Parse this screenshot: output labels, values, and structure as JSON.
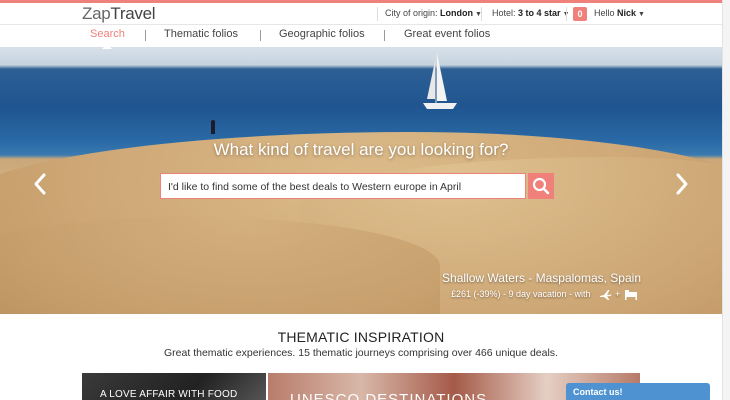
{
  "header": {
    "logo_zap": "Zap",
    "logo_travel": "Travel",
    "city_label": "City of origin:",
    "city_value": "London",
    "hotel_label": "Hotel:",
    "hotel_value": "3 to 4 star",
    "notifications_count": "0",
    "greeting": "Hello",
    "user_name": "Nick"
  },
  "nav": {
    "items": [
      "Search",
      "Thematic folios",
      "Geographic folios",
      "Great event folios"
    ],
    "active": "Search"
  },
  "hero": {
    "title": "What kind of travel are you looking for?",
    "search_value": "I'd like to find some of the best deals to Western europe in April",
    "caption": "Shallow Waters - Maspalomas, Spain",
    "sub_caption": "£261 (-39%) - 9 day vacation - with",
    "plus": "+"
  },
  "section": {
    "title": "THEMATIC INSPIRATION",
    "subtitle": "Great thematic experiences. 15 thematic journeys comprising over 466 unique deals.",
    "tiles": [
      {
        "label": "A LOVE AFFAIR WITH FOOD"
      },
      {
        "label": "UNESCO DESTINATIONS"
      }
    ]
  },
  "contact": {
    "label": "Contact us!"
  },
  "colors": {
    "accent": "#f0807a",
    "contact": "#4e92d1"
  }
}
